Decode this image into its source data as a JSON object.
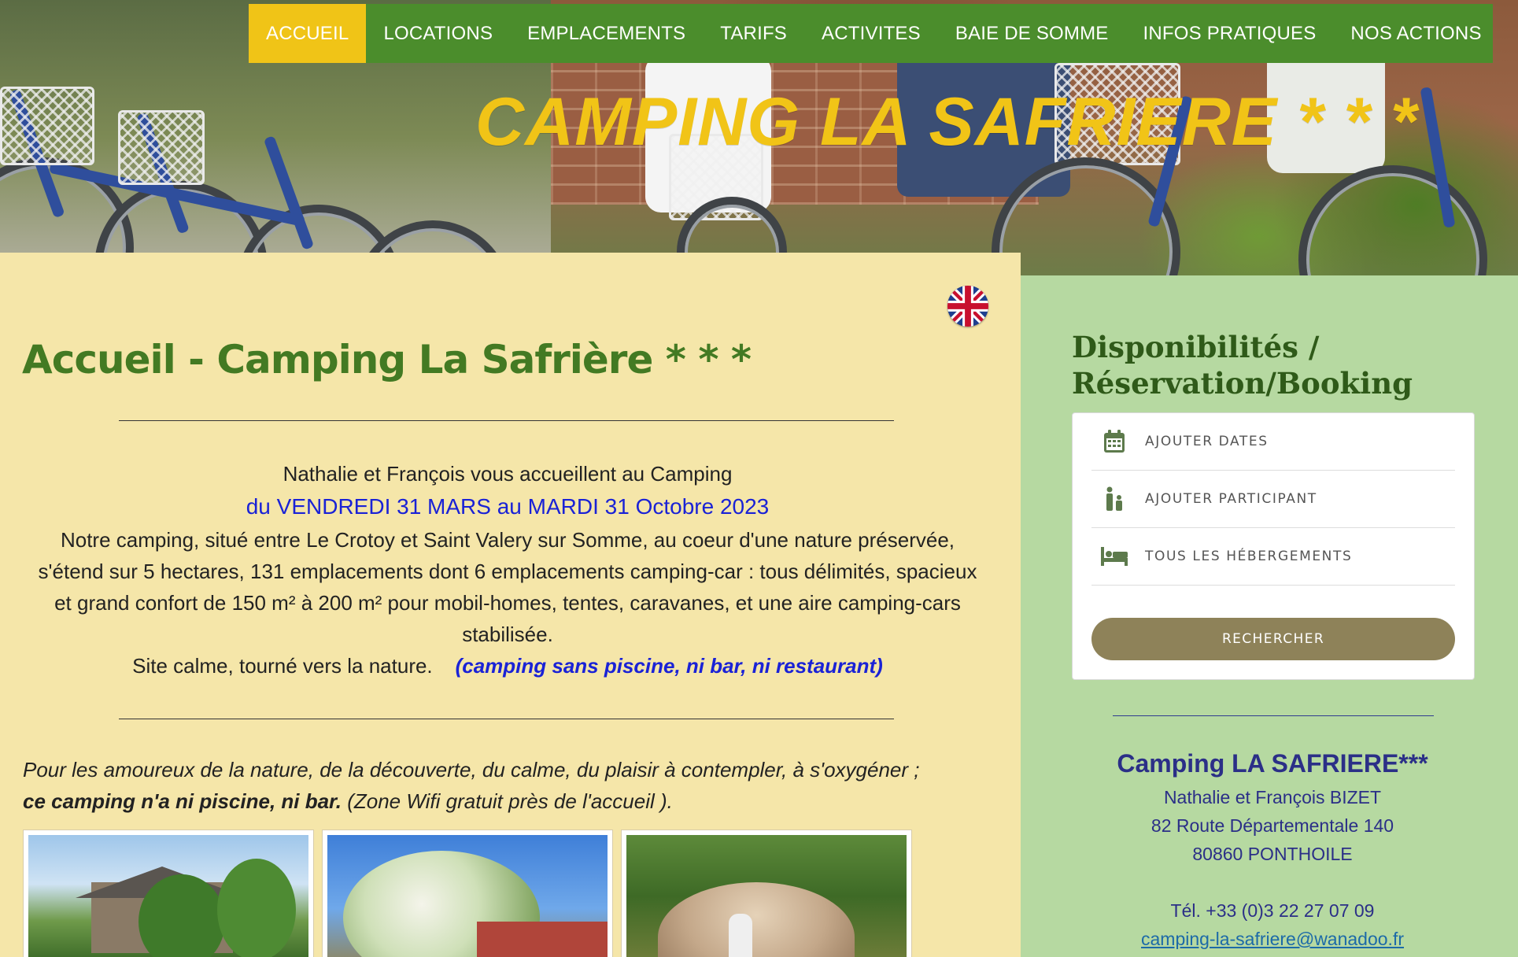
{
  "nav": {
    "items": [
      {
        "label": "ACCUEIL",
        "active": true
      },
      {
        "label": "LOCATIONS"
      },
      {
        "label": "EMPLACEMENTS"
      },
      {
        "label": "TARIFS"
      },
      {
        "label": "ACTIVITES"
      },
      {
        "label": "BAIE DE SOMME"
      },
      {
        "label": "INFOS PRATIQUES"
      },
      {
        "label": "NOS ACTIONS"
      }
    ]
  },
  "hero": {
    "title": "CAMPING  LA SAFRIERE * * *"
  },
  "language": {
    "icon": "uk-flag-icon"
  },
  "main": {
    "title": "Accueil - Camping La Safrière * * *",
    "welcome": "Nathalie et François vous accueillent au Camping",
    "dates": "du VENDREDI 31 MARS au MARDI 31 Octobre 2023",
    "description": "Notre camping, situé entre Le Crotoy et Saint Valery sur Somme, au coeur d'une nature préservée, s'étend sur 5 hectares, 131 emplacements dont 6 emplacements camping-car : tous délimités, spacieux et grand confort de 150 m² à 200 m² pour mobil-homes, tentes, caravanes, et une aire camping-cars stabilisée.",
    "calm": "Site calme, tourné vers la nature.",
    "calm_note": "(camping sans piscine, ni bar, ni restaurant)",
    "intro_line1": "Pour les amoureux de la nature, de la découverte, du calme, du plaisir à contempler, à s'oxygéner ;",
    "intro_bold": "ce camping n'a ni piscine, ni bar.",
    "intro_rest": " (Zone Wifi gratuit près de l'accueil )."
  },
  "sidebar": {
    "title_line1": "Disponibilités /",
    "title_line2": "Réservation/Booking",
    "booking": {
      "dates_label": "AJOUTER DATES",
      "dates_icon": "calendar-icon",
      "participants_label": "AJOUTER PARTICIPANT",
      "participants_icon": "family-icon",
      "lodging_label": "TOUS LES HÉBERGEMENTS",
      "lodging_icon": "bed-icon",
      "search_label": "RECHERCHER"
    },
    "contact": {
      "name": "Camping LA SAFRIERE***",
      "owners": "Nathalie et François BIZET",
      "address1": "82 Route Départementale 140",
      "address2": "80860 PONTHOILE",
      "phone": "Tél. +33 (0)3 22 27 07 09",
      "email": "camping-la-safriere@wanadoo.fr"
    }
  },
  "colors": {
    "nav_green": "#4b8d2c",
    "nav_active": "#f0c417",
    "title_yellow": "#f1c417",
    "page_bg": "#f5e6a9",
    "sidebar_bg": "#b6d9a1",
    "heading_green": "#437a23",
    "dates_blue": "#1a22d6",
    "button_brown": "#8e8259",
    "contact_blue": "#2b2f87"
  }
}
